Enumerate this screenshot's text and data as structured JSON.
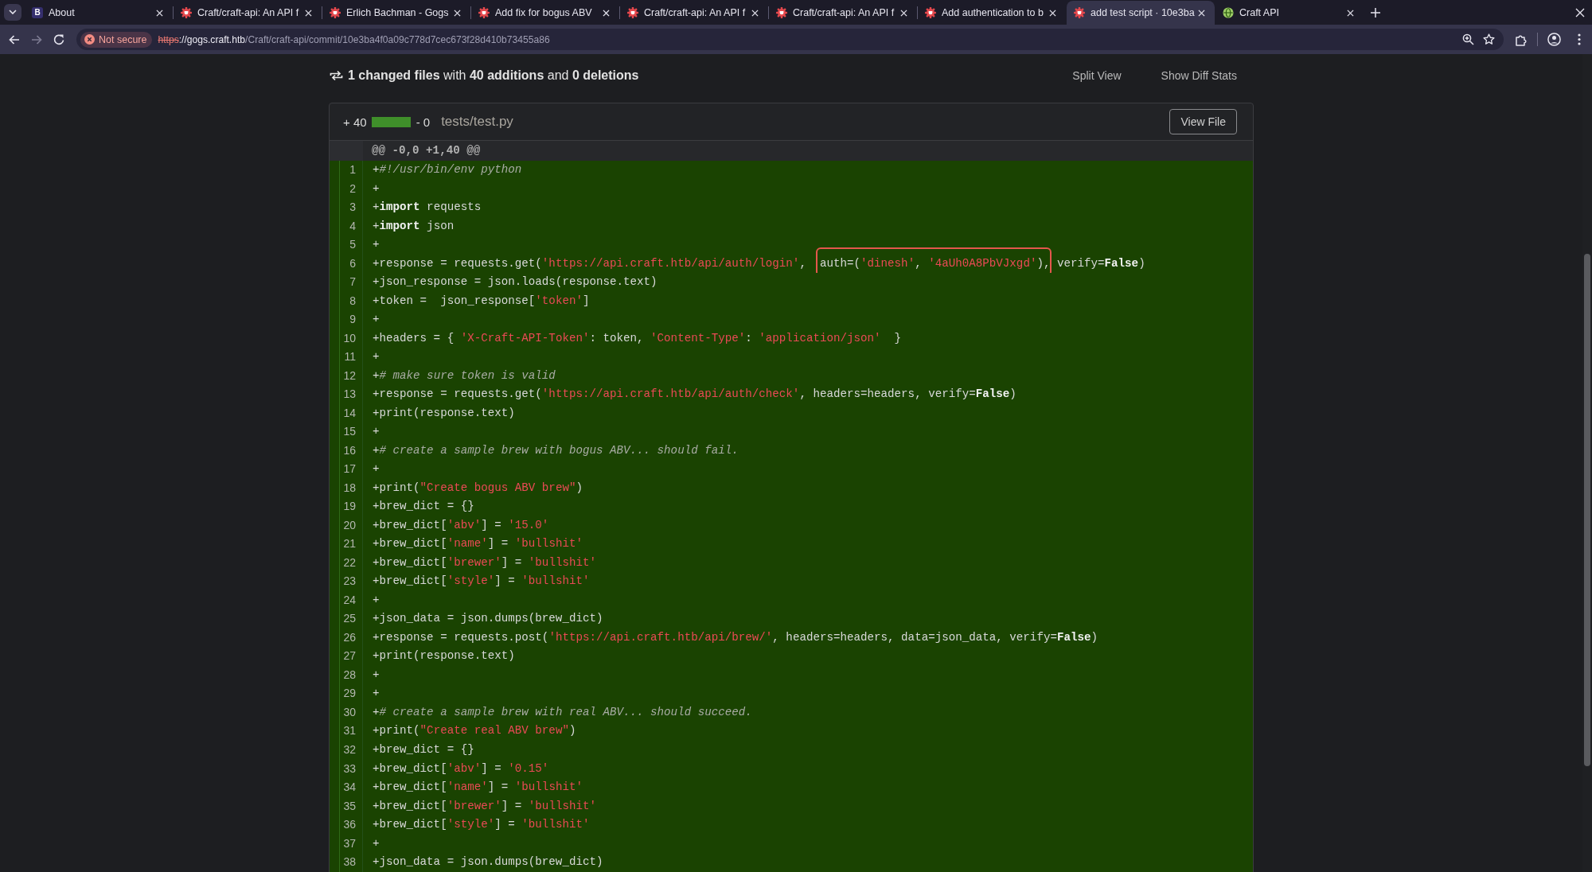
{
  "browser": {
    "tabs": [
      {
        "kind": "letter",
        "letter": "B",
        "title": "About",
        "selected": false
      },
      {
        "kind": "gogs",
        "title": "Craft/craft-api: An API f",
        "selected": false
      },
      {
        "kind": "gogs",
        "title": "Erlich Bachman - Gogs",
        "selected": false
      },
      {
        "kind": "gogs",
        "title": "Add fix for bogus ABV",
        "selected": false
      },
      {
        "kind": "gogs",
        "title": "Craft/craft-api: An API f",
        "selected": false
      },
      {
        "kind": "gogs",
        "title": "Craft/craft-api: An API f",
        "selected": false
      },
      {
        "kind": "gogs",
        "title": "Add authentication to b",
        "selected": false
      },
      {
        "kind": "gogs",
        "title": "add test script · 10e3ba",
        "selected": true
      },
      {
        "kind": "globe",
        "title": "Craft API",
        "selected": false
      }
    ],
    "nav_buttons": [
      {
        "kind": "back",
        "disabled": false
      },
      {
        "kind": "forward",
        "disabled": true
      },
      {
        "kind": "reload",
        "disabled": false
      }
    ],
    "address_bar": {
      "security": {
        "label": "Not secure",
        "secure": false
      },
      "scheme": "https",
      "host": "://gogs.craft.htb",
      "path": "/Craft/craft-api/commit/10e3ba4f0a09c778d7cec673f28d410b73455a86"
    }
  },
  "diff": {
    "summary": "**1 changed files** with **40 additions** and **0 deletions**",
    "view_buttons": [
      "Split View",
      "Show Diff Stats"
    ],
    "file": {
      "additions": "+ 40",
      "deletions": "- 0",
      "level": 1,
      "name": "tests/test.py",
      "button": "View File",
      "hunk": "@@ -0,0 +1,40 @@",
      "lines": [
        {
          "kind": "add",
          "number": "1",
          "tokens": [
            {
              "kind": "plain",
              "text": "+"
            },
            {
              "kind": "comment",
              "text": "#!/usr/bin/env python"
            }
          ]
        },
        {
          "kind": "add",
          "number": "2",
          "tokens": [
            {
              "kind": "plain",
              "text": "+"
            }
          ]
        },
        {
          "kind": "add",
          "number": "3",
          "tokens": [
            {
              "kind": "plain",
              "text": "+"
            },
            {
              "kind": "keyword",
              "text": "import"
            },
            {
              "kind": "plain",
              "text": " requests"
            }
          ]
        },
        {
          "kind": "add",
          "number": "4",
          "tokens": [
            {
              "kind": "plain",
              "text": "+"
            },
            {
              "kind": "keyword",
              "text": "import"
            },
            {
              "kind": "plain",
              "text": " json"
            }
          ]
        },
        {
          "kind": "add",
          "number": "5",
          "tokens": [
            {
              "kind": "plain",
              "text": "+"
            }
          ]
        },
        {
          "kind": "add",
          "number": "6",
          "tokens": [
            {
              "kind": "plain",
              "text": "+response = requests.get(",
              "boxed": false
            },
            {
              "kind": "string",
              "text": "'https://api.craft.htb/api/auth/login'",
              "boxed": false
            },
            {
              "kind": "plain",
              "text": ",  ",
              "boxed": false
            },
            {
              "kind": "plain",
              "text": "auth=(",
              "boxed": true
            },
            {
              "kind": "string",
              "text": "'dinesh'",
              "boxed": true
            },
            {
              "kind": "plain",
              "text": ", ",
              "boxed": true
            },
            {
              "kind": "string",
              "text": "'4aUh0A8PbVJxgd'",
              "boxed": true
            },
            {
              "kind": "plain",
              "text": ")",
              "boxed": true
            },
            {
              "kind": "plain",
              "text": ", verify=",
              "boxed": false
            },
            {
              "kind": "keyword",
              "text": "False",
              "boxed": false
            },
            {
              "kind": "plain",
              "text": ")",
              "boxed": false
            }
          ]
        },
        {
          "kind": "add",
          "number": "7",
          "tokens": [
            {
              "kind": "plain",
              "text": "+json_response = json.loads(response.text)"
            }
          ]
        },
        {
          "kind": "add",
          "number": "8",
          "tokens": [
            {
              "kind": "plain",
              "text": "+token =  json_response["
            },
            {
              "kind": "string",
              "text": "'token'"
            },
            {
              "kind": "plain",
              "text": "]"
            }
          ]
        },
        {
          "kind": "add",
          "number": "9",
          "tokens": [
            {
              "kind": "plain",
              "text": "+"
            }
          ]
        },
        {
          "kind": "add",
          "number": "10",
          "tokens": [
            {
              "kind": "plain",
              "text": "+headers = { "
            },
            {
              "kind": "string",
              "text": "'X-Craft-API-Token'"
            },
            {
              "kind": "plain",
              "text": ": token, "
            },
            {
              "kind": "string",
              "text": "'Content-Type'"
            },
            {
              "kind": "plain",
              "text": ": "
            },
            {
              "kind": "string",
              "text": "'application/json'"
            },
            {
              "kind": "plain",
              "text": "  }"
            }
          ]
        },
        {
          "kind": "add",
          "number": "11",
          "tokens": [
            {
              "kind": "plain",
              "text": "+"
            }
          ]
        },
        {
          "kind": "add",
          "number": "12",
          "tokens": [
            {
              "kind": "plain",
              "text": "+"
            },
            {
              "kind": "comment",
              "text": "# make sure token is valid"
            }
          ]
        },
        {
          "kind": "add",
          "number": "13",
          "tokens": [
            {
              "kind": "plain",
              "text": "+response = requests.get("
            },
            {
              "kind": "string",
              "text": "'https://api.craft.htb/api/auth/check'"
            },
            {
              "kind": "plain",
              "text": ", headers=headers, verify="
            },
            {
              "kind": "keyword",
              "text": "False"
            },
            {
              "kind": "plain",
              "text": ")"
            }
          ]
        },
        {
          "kind": "add",
          "number": "14",
          "tokens": [
            {
              "kind": "plain",
              "text": "+print(response.text)"
            }
          ]
        },
        {
          "kind": "add",
          "number": "15",
          "tokens": [
            {
              "kind": "plain",
              "text": "+"
            }
          ]
        },
        {
          "kind": "add",
          "number": "16",
          "tokens": [
            {
              "kind": "plain",
              "text": "+"
            },
            {
              "kind": "comment",
              "text": "# create a sample brew with bogus ABV... should fail."
            }
          ]
        },
        {
          "kind": "add",
          "number": "17",
          "tokens": [
            {
              "kind": "plain",
              "text": "+"
            }
          ]
        },
        {
          "kind": "add",
          "number": "18",
          "tokens": [
            {
              "kind": "plain",
              "text": "+print("
            },
            {
              "kind": "string",
              "text": "\"Create bogus ABV brew\""
            },
            {
              "kind": "plain",
              "text": ")"
            }
          ]
        },
        {
          "kind": "add",
          "number": "19",
          "tokens": [
            {
              "kind": "plain",
              "text": "+brew_dict = {}"
            }
          ]
        },
        {
          "kind": "add",
          "number": "20",
          "tokens": [
            {
              "kind": "plain",
              "text": "+brew_dict["
            },
            {
              "kind": "string",
              "text": "'abv'"
            },
            {
              "kind": "plain",
              "text": "] = "
            },
            {
              "kind": "string",
              "text": "'15.0'"
            }
          ]
        },
        {
          "kind": "add",
          "number": "21",
          "tokens": [
            {
              "kind": "plain",
              "text": "+brew_dict["
            },
            {
              "kind": "string",
              "text": "'name'"
            },
            {
              "kind": "plain",
              "text": "] = "
            },
            {
              "kind": "string",
              "text": "'bullshit'"
            }
          ]
        },
        {
          "kind": "add",
          "number": "22",
          "tokens": [
            {
              "kind": "plain",
              "text": "+brew_dict["
            },
            {
              "kind": "string",
              "text": "'brewer'"
            },
            {
              "kind": "plain",
              "text": "] = "
            },
            {
              "kind": "string",
              "text": "'bullshit'"
            }
          ]
        },
        {
          "kind": "add",
          "number": "23",
          "tokens": [
            {
              "kind": "plain",
              "text": "+brew_dict["
            },
            {
              "kind": "string",
              "text": "'style'"
            },
            {
              "kind": "plain",
              "text": "] = "
            },
            {
              "kind": "string",
              "text": "'bullshit'"
            }
          ]
        },
        {
          "kind": "add",
          "number": "24",
          "tokens": [
            {
              "kind": "plain",
              "text": "+"
            }
          ]
        },
        {
          "kind": "add",
          "number": "25",
          "tokens": [
            {
              "kind": "plain",
              "text": "+json_data = json.dumps(brew_dict)"
            }
          ]
        },
        {
          "kind": "add",
          "number": "26",
          "tokens": [
            {
              "kind": "plain",
              "text": "+response = requests.post("
            },
            {
              "kind": "string",
              "text": "'https://api.craft.htb/api/brew/'"
            },
            {
              "kind": "plain",
              "text": ", headers=headers, data=json_data, verify="
            },
            {
              "kind": "keyword",
              "text": "False"
            },
            {
              "kind": "plain",
              "text": ")"
            }
          ]
        },
        {
          "kind": "add",
          "number": "27",
          "tokens": [
            {
              "kind": "plain",
              "text": "+print(response.text)"
            }
          ]
        },
        {
          "kind": "add",
          "number": "28",
          "tokens": [
            {
              "kind": "plain",
              "text": "+"
            }
          ]
        },
        {
          "kind": "add",
          "number": "29",
          "tokens": [
            {
              "kind": "plain",
              "text": "+"
            }
          ]
        },
        {
          "kind": "add",
          "number": "30",
          "tokens": [
            {
              "kind": "plain",
              "text": "+"
            },
            {
              "kind": "comment",
              "text": "# create a sample brew with real ABV... should succeed."
            }
          ]
        },
        {
          "kind": "add",
          "number": "31",
          "tokens": [
            {
              "kind": "plain",
              "text": "+print("
            },
            {
              "kind": "string",
              "text": "\"Create real ABV brew\""
            },
            {
              "kind": "plain",
              "text": ")"
            }
          ]
        },
        {
          "kind": "add",
          "number": "32",
          "tokens": [
            {
              "kind": "plain",
              "text": "+brew_dict = {}"
            }
          ]
        },
        {
          "kind": "add",
          "number": "33",
          "tokens": [
            {
              "kind": "plain",
              "text": "+brew_dict["
            },
            {
              "kind": "string",
              "text": "'abv'"
            },
            {
              "kind": "plain",
              "text": "] = "
            },
            {
              "kind": "string",
              "text": "'0.15'"
            }
          ]
        },
        {
          "kind": "add",
          "number": "34",
          "tokens": [
            {
              "kind": "plain",
              "text": "+brew_dict["
            },
            {
              "kind": "string",
              "text": "'name'"
            },
            {
              "kind": "plain",
              "text": "] = "
            },
            {
              "kind": "string",
              "text": "'bullshit'"
            }
          ]
        },
        {
          "kind": "add",
          "number": "35",
          "tokens": [
            {
              "kind": "plain",
              "text": "+brew_dict["
            },
            {
              "kind": "string",
              "text": "'brewer'"
            },
            {
              "kind": "plain",
              "text": "] = "
            },
            {
              "kind": "string",
              "text": "'bullshit'"
            }
          ]
        },
        {
          "kind": "add",
          "number": "36",
          "tokens": [
            {
              "kind": "plain",
              "text": "+brew_dict["
            },
            {
              "kind": "string",
              "text": "'style'"
            },
            {
              "kind": "plain",
              "text": "] = "
            },
            {
              "kind": "string",
              "text": "'bullshit'"
            }
          ]
        },
        {
          "kind": "add",
          "number": "37",
          "tokens": [
            {
              "kind": "plain",
              "text": "+"
            }
          ]
        },
        {
          "kind": "add",
          "number": "38",
          "tokens": [
            {
              "kind": "plain",
              "text": "+json_data = json.dumps(brew_dict)"
            }
          ]
        }
      ]
    }
  }
}
